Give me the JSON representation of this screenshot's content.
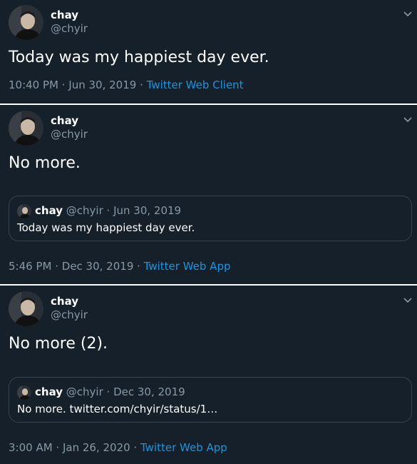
{
  "colors": {
    "background": "#15202b",
    "link": "#1b95e0",
    "secondary": "#8899a6",
    "border": "#38444d"
  },
  "tweets": [
    {
      "name": "chay",
      "handle": "@chyir",
      "text": "Today was my happiest day ever.",
      "time": "10:40 PM",
      "date": "Jun 30, 2019",
      "app": "Twitter Web Client"
    },
    {
      "name": "chay",
      "handle": "@chyir",
      "text": "No more.",
      "quote": {
        "name": "chay",
        "handle": "@chyir",
        "date": "Jun 30, 2019",
        "text": "Today was my happiest day ever."
      },
      "time": "5:46 PM",
      "date": "Dec 30, 2019",
      "app": "Twitter Web App"
    },
    {
      "name": "chay",
      "handle": "@chyir",
      "text": "No more (2).",
      "quote": {
        "name": "chay",
        "handle": "@chyir",
        "date": "Dec 30, 2019",
        "text": "No more. twitter.com/chyir/status/1…"
      },
      "time": "3:00 AM",
      "date": "Jan 26, 2020",
      "app": "Twitter Web App"
    }
  ],
  "separator": " · ",
  "icons": {
    "chevron": "chevron-down-icon",
    "avatar": "avatar"
  }
}
